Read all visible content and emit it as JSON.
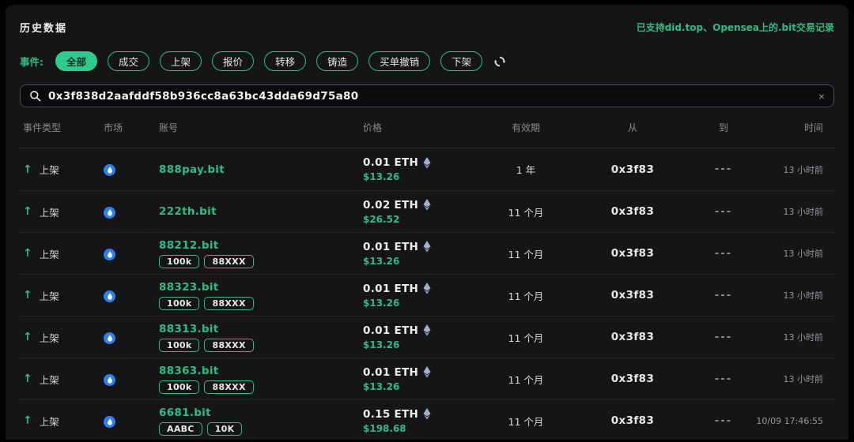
{
  "page": {
    "title": "历史数据",
    "support_note": "已支持did.top、Opensea上的.bit交易记录"
  },
  "filters": {
    "label": "事件:",
    "options": [
      {
        "label": "全部",
        "active": true
      },
      {
        "label": "成交",
        "active": false
      },
      {
        "label": "上架",
        "active": false
      },
      {
        "label": "报价",
        "active": false
      },
      {
        "label": "转移",
        "active": false
      },
      {
        "label": "铸造",
        "active": false
      },
      {
        "label": "买单撤销",
        "active": false
      },
      {
        "label": "下架",
        "active": false
      }
    ]
  },
  "search": {
    "value": "0x3f838d2aafddf58b936cc8a63bc43dda69d75a80",
    "clear_glyph": "×"
  },
  "icons": {
    "search": "magnifier",
    "refresh": "circular-arrows",
    "market": "did-top-blue-droplet",
    "eth": "ethereum-diamond",
    "event_up_arrow": "↑"
  },
  "colors": {
    "accent_green": "#2ebd85",
    "active_pill_bg": "#2fca8e",
    "market_blue": "#2e80f2",
    "eth_lavender": "#a0a7c9",
    "usd_green": "#2ebd85",
    "panel_bg": "#151517"
  },
  "table": {
    "columns": [
      "事件类型",
      "市场",
      "账号",
      "价格",
      "有效期",
      "从",
      "到",
      "时间"
    ],
    "rows": [
      {
        "event": "上架",
        "account": "888pay.bit",
        "tags": [],
        "price_eth": "0.01 ETH",
        "price_usd": "$13.26",
        "validity": "1 年",
        "from": "0x3f83",
        "to": "---",
        "time": "13 小时前"
      },
      {
        "event": "上架",
        "account": "222th.bit",
        "tags": [],
        "price_eth": "0.02 ETH",
        "price_usd": "$26.52",
        "validity": "11 个月",
        "from": "0x3f83",
        "to": "---",
        "time": "13 小时前"
      },
      {
        "event": "上架",
        "account": "88212.bit",
        "tags": [
          "100k",
          "88XXX"
        ],
        "price_eth": "0.01 ETH",
        "price_usd": "$13.26",
        "validity": "11 个月",
        "from": "0x3f83",
        "to": "---",
        "time": "13 小时前"
      },
      {
        "event": "上架",
        "account": "88323.bit",
        "tags": [
          "100k",
          "88XXX"
        ],
        "price_eth": "0.01 ETH",
        "price_usd": "$13.26",
        "validity": "11 个月",
        "from": "0x3f83",
        "to": "---",
        "time": "13 小时前"
      },
      {
        "event": "上架",
        "account": "88313.bit",
        "tags": [
          "100k",
          "88XXX"
        ],
        "price_eth": "0.01 ETH",
        "price_usd": "$13.26",
        "validity": "11 个月",
        "from": "0x3f83",
        "to": "---",
        "time": "13 小时前"
      },
      {
        "event": "上架",
        "account": "88363.bit",
        "tags": [
          "100k",
          "88XXX"
        ],
        "price_eth": "0.01 ETH",
        "price_usd": "$13.26",
        "validity": "11 个月",
        "from": "0x3f83",
        "to": "---",
        "time": "13 小时前"
      },
      {
        "event": "上架",
        "account": "6681.bit",
        "tags": [
          "AABC",
          "10K"
        ],
        "price_eth": "0.15 ETH",
        "price_usd": "$198.68",
        "validity": "11 个月",
        "from": "0x3f83",
        "to": "---",
        "time": "10/09 17:46:55"
      }
    ]
  }
}
